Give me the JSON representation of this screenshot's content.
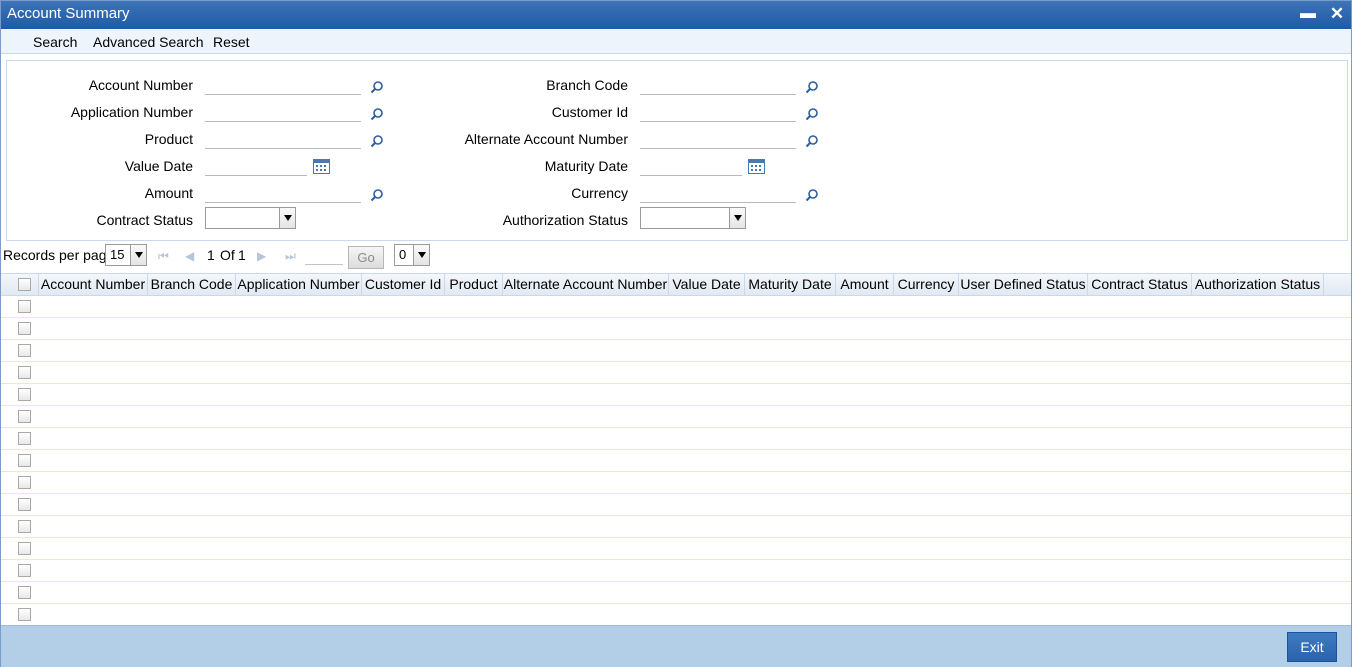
{
  "window": {
    "title": "Account Summary",
    "minimize_icon": "minimize-icon",
    "close_icon": "close-icon"
  },
  "toolbar": {
    "search": "Search",
    "advanced_search": "Advanced Search",
    "reset": "Reset"
  },
  "criteria": {
    "account_number": "Account Number",
    "application_number": "Application Number",
    "product": "Product",
    "value_date": "Value Date",
    "amount": "Amount",
    "contract_status": "Contract Status",
    "branch_code": "Branch Code",
    "customer_id": "Customer Id",
    "alternate_account_number": "Alternate Account Number",
    "maturity_date": "Maturity Date",
    "currency": "Currency",
    "authorization_status": "Authorization Status",
    "contract_status_value": "",
    "authorization_status_value": ""
  },
  "pager": {
    "records_per_page_label": "Records per page",
    "records_per_page_value": "15",
    "page_current": "1",
    "page_of": "Of",
    "page_total": "1",
    "go_label": "Go",
    "lock_value": "0"
  },
  "grid": {
    "columns": [
      "Account Number",
      "Branch Code",
      "Application Number",
      "Customer Id",
      "Product",
      "Alternate Account Number",
      "Value Date",
      "Maturity Date",
      "Amount",
      "Currency",
      "User Defined Status",
      "Contract Status",
      "Authorization Status"
    ],
    "row_count": 15
  },
  "footer": {
    "exit_label": "Exit"
  },
  "colors": {
    "title_bar": "#2a63ad",
    "footer": "#b3cfe8",
    "accent": "#2a63ad"
  }
}
